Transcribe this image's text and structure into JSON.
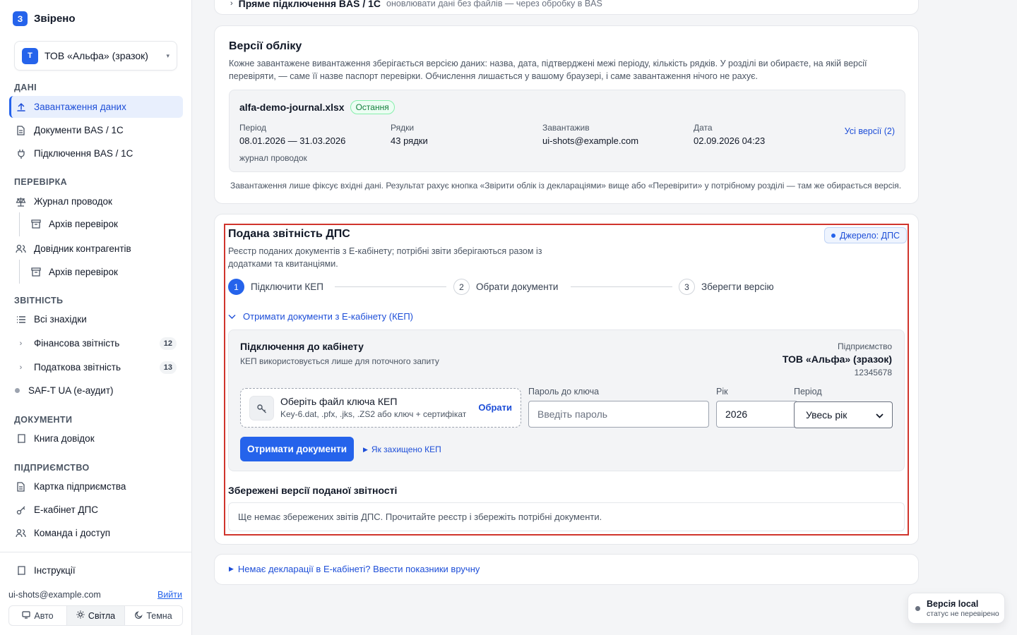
{
  "brand": {
    "logo_letter": "З",
    "name": "Звірено"
  },
  "org": {
    "avatar_letter": "Т",
    "name": "ТОВ «Альфа» (зразок)",
    "caret": "▾"
  },
  "nav": {
    "sections": {
      "data": "ДАНІ",
      "check": "ПЕРЕВІРКА",
      "reports": "ЗВІТНІСТЬ",
      "docs": "ДОКУМЕНТИ",
      "company": "ПІДПРИЄМСТВО"
    },
    "upload": "Завантаження даних",
    "bas_docs": "Документи BAS / 1C",
    "bas_conn": "Підключення BAS / 1C",
    "journal": "Журнал проводок",
    "journal_archive": "Архів перевірок",
    "counterparties": "Довідник контрагентів",
    "counterparties_archive": "Архів перевірок",
    "all_findings": "Всі знахідки",
    "financial": "Фінансова звітність",
    "financial_count": "12",
    "tax": "Податкова звітність",
    "tax_count": "13",
    "saft": "SAF-T UA (е-аудит)",
    "cert_book": "Книга довідок",
    "company_card": "Картка підприємства",
    "ecabinet": "Е-кабінет ДПС",
    "team": "Команда і доступ",
    "instructions": "Інструкції"
  },
  "user": {
    "email": "ui-shots@example.com",
    "logout": "Вийти"
  },
  "theme": {
    "auto": "Авто",
    "light": "Світла",
    "dark": "Темна",
    "selected": "Світла"
  },
  "top_card": {
    "title": "Пряме підключення BAS / 1C",
    "subtitle": "оновлювати дані без файлів — через обробку в BAS"
  },
  "versions": {
    "title": "Версії обліку",
    "description": "Кожне завантажене вивантаження зберігається версією даних: назва, дата, підтверджені межі періоду, кількість рядків. У розділі ви обираєте, на якій версії перевіряти, — саме її назве паспорт перевірки. Обчислення лишається у вашому браузері, і саме завантаження нічого не рахує.",
    "file_name": "alfa-demo-journal.xlsx",
    "badge": "Остання",
    "period_label": "Період",
    "period_value": "08.01.2026 — 31.03.2026",
    "rows_label": "Рядки",
    "rows_value": "43 рядки",
    "uploader_label": "Завантажив",
    "uploader_value": "ui-shots@example.com",
    "date_label": "Дата",
    "date_value": "02.09.2026 04:23",
    "kind": "журнал проводок",
    "all_versions": "Усі версії (2)",
    "footnote": "Завантаження лише фіксує вхідні дані. Результат рахує кнопка «Звірити облік із деклараціями» вище або «Перевірити» у потрібному розділі — там же обирається версія."
  },
  "dps": {
    "title": "Подана звітність ДПС",
    "description": "Реєстр поданих документів з Е-кабінету; потрібні звіти зберігаються разом із додатками та квитанціями.",
    "source_badge": "Джерело: ДПС",
    "steps": [
      {
        "num": "1",
        "label": "Підключити КЕП"
      },
      {
        "num": "2",
        "label": "Обрати документи"
      },
      {
        "num": "3",
        "label": "Зберегти версію"
      }
    ],
    "expander": "Отримати документи з Е-кабінету (КЕП)",
    "connect_title": "Підключення до кабінету",
    "connect_note": "КЕП використовується лише для поточного запиту",
    "company_label": "Підприємство",
    "company_name": "ТОВ «Альфа» (зразок)",
    "company_code": "12345678",
    "file_title": "Оберіть файл ключа КЕП",
    "file_hint": "Key-6.dat, .pfx, .jks, .ZS2 або ключ + сертифікат",
    "file_choose": "Обрати",
    "password_label": "Пароль до ключа",
    "password_placeholder": "Введіть пароль",
    "year_label": "Рік",
    "year_value": "2026",
    "period_label": "Період",
    "period_value": "Увесь рік",
    "get_button": "Отримати документи",
    "kep_help": "Як захищено КЕП",
    "saved_title": "Збережені версії поданої звітності",
    "saved_empty": "Ще немає збережених звітів ДПС. Прочитайте реєстр і збережіть потрібні документи."
  },
  "manual": {
    "label": "Немає декларації в Е-кабінеті? Ввести показники вручну"
  },
  "toast": {
    "title": "Версія local",
    "subtitle": "статус не перевірено"
  },
  "colors": {
    "accent": "#2563eb",
    "highlight_frame": "#d0342c",
    "badge_green": "#15803d"
  },
  "icons": [
    "upload-icon",
    "document-icon",
    "plug-icon",
    "scales-icon",
    "archive-icon",
    "users-icon",
    "list-icon",
    "chevron-right-icon",
    "book-icon",
    "building-icon",
    "key-icon",
    "team-icon",
    "monitor-icon",
    "sun-icon",
    "moon-icon"
  ]
}
